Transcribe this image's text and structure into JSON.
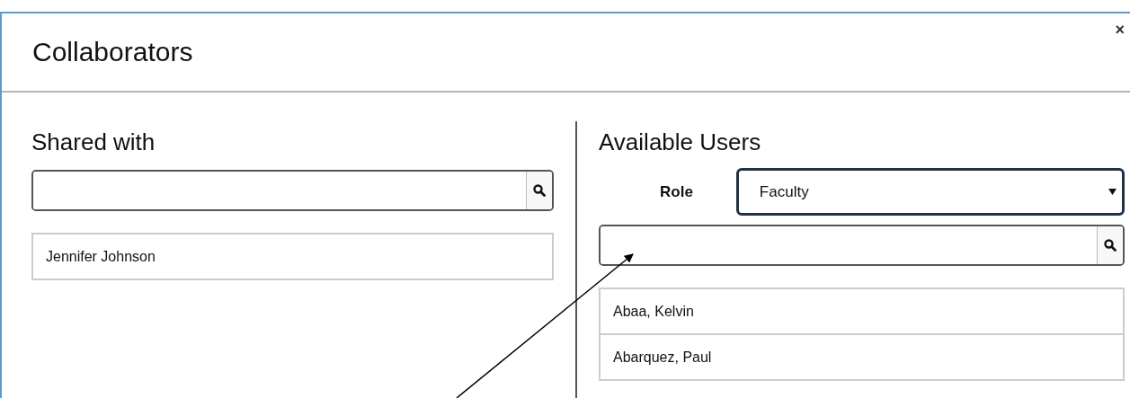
{
  "dialog": {
    "title": "Collaborators",
    "close": "×"
  },
  "shared": {
    "heading": "Shared with",
    "items": [
      {
        "name": "Jennifer Johnson"
      }
    ]
  },
  "available": {
    "heading": "Available Users",
    "role": {
      "label": "Role",
      "value": "Faculty"
    },
    "items": [
      {
        "name": "Abaa, Kelvin"
      },
      {
        "name": "Abarquez, Paul"
      }
    ]
  }
}
